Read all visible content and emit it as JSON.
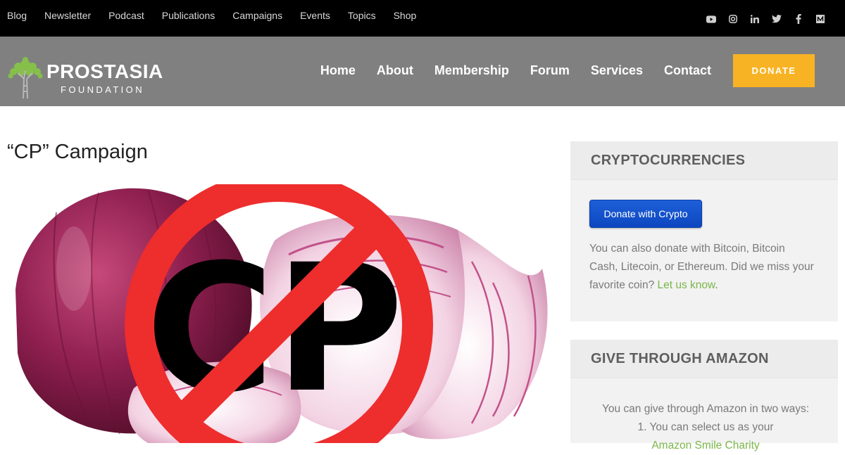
{
  "topnav": [
    "Blog",
    "Newsletter",
    "Podcast",
    "Publications",
    "Campaigns",
    "Events",
    "Topics",
    "Shop"
  ],
  "social": [
    "youtube-icon",
    "instagram-icon",
    "linkedin-icon",
    "twitter-icon",
    "facebook-icon",
    "medium-icon"
  ],
  "brand": {
    "name": "PROSTASIA",
    "sub": "FOUNDATION"
  },
  "mainnav": [
    "Home",
    "About",
    "Membership",
    "Forum",
    "Services",
    "Contact"
  ],
  "donate_label": "DONATE",
  "page": {
    "title": "“CP” Campaign",
    "hero_text": "CP"
  },
  "sidebar": {
    "crypto": {
      "heading": "CRYPTOCURRENCIES",
      "button": "Donate with Crypto",
      "text": "You can also donate with Bitcoin, Bitcoin Cash, Litecoin, or Ethereum. Did we miss your favorite coin? ",
      "link": "Let us know",
      "after": "."
    },
    "amazon": {
      "heading": "GIVE THROUGH AMAZON",
      "intro": "You can give through Amazon in two ways:",
      "item1": "1. You can select us as your",
      "item1_link": "Amazon Smile Charity"
    }
  },
  "colors": {
    "accent": "#f8b324",
    "link": "#7ab648",
    "prohibition": "#ee2d2d",
    "onion": "#8a1d4a"
  }
}
